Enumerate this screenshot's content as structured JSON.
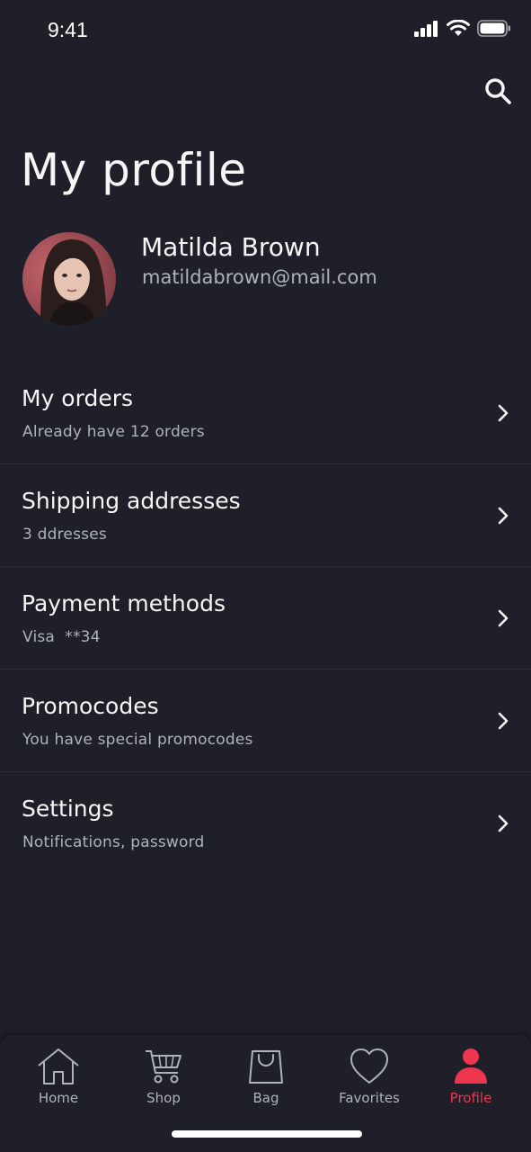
{
  "status_bar": {
    "time": "9:41"
  },
  "header": {
    "title": "My profile",
    "search_icon": "search-icon"
  },
  "user": {
    "name": "Matilda Brown",
    "email": "matildabrown@mail.com"
  },
  "menu": [
    {
      "title": "My orders",
      "subtitle": "Already have 12 orders"
    },
    {
      "title": "Shipping addresses",
      "subtitle": "3 ddresses"
    },
    {
      "title": "Payment methods",
      "subtitle": "Visa  **34"
    },
    {
      "title": "Promocodes",
      "subtitle": "You have special promocodes"
    },
    {
      "title": "Settings",
      "subtitle": "Notifications, password"
    }
  ],
  "tabs": [
    {
      "label": "Home",
      "icon": "home-icon"
    },
    {
      "label": "Shop",
      "icon": "cart-icon"
    },
    {
      "label": "Bag",
      "icon": "bag-icon"
    },
    {
      "label": "Favorites",
      "icon": "heart-icon"
    },
    {
      "label": "Profile",
      "icon": "profile-icon",
      "active": true
    }
  ],
  "colors": {
    "background": "#1e1f28",
    "accent": "#ef3651",
    "text": "#f6f6f6",
    "muted": "#abb4bd"
  }
}
